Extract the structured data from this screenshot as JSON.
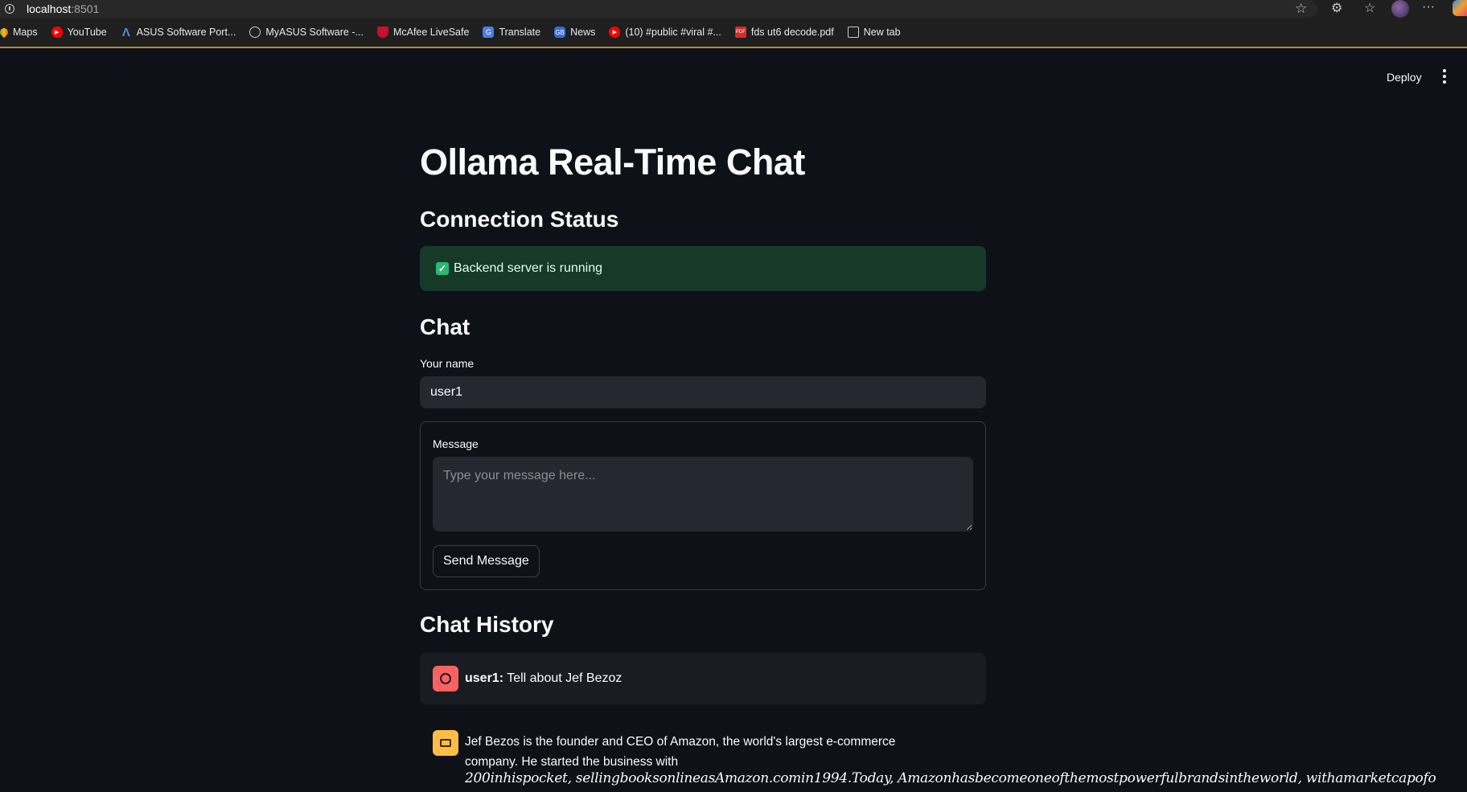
{
  "browser": {
    "url_host": "localhost",
    "url_port": ":8501",
    "bookmarks": [
      {
        "label": "Maps",
        "icon": "maps-icon"
      },
      {
        "label": "YouTube",
        "icon": "youtube-icon"
      },
      {
        "label": "ASUS Software Port...",
        "icon": "asus-icon"
      },
      {
        "label": "MyASUS Software -...",
        "icon": "globe-icon"
      },
      {
        "label": "McAfee LiveSafe",
        "icon": "mcafee-icon"
      },
      {
        "label": "Translate",
        "icon": "translate-icon"
      },
      {
        "label": "News",
        "icon": "news-icon"
      },
      {
        "label": "(10) #public #viral #...",
        "icon": "youtube-icon"
      },
      {
        "label": "fds ut6 decode.pdf",
        "icon": "pdf-icon"
      },
      {
        "label": "New tab",
        "icon": "newtab-icon"
      }
    ]
  },
  "header": {
    "deploy_label": "Deploy"
  },
  "page": {
    "title": "Ollama Real-Time Chat",
    "connection_heading": "Connection Status",
    "status_message": "Backend server is running",
    "chat_heading": "Chat",
    "name_label": "Your name",
    "name_value": "user1",
    "message_label": "Message",
    "message_placeholder": "Type your message here...",
    "send_label": "Send Message",
    "history_heading": "Chat History"
  },
  "chat_history": {
    "user_message": {
      "author": "user1:",
      "text": " Tell about Jef Bezoz"
    },
    "bot_message": {
      "text": "Jef Bezos is the founder and CEO of Amazon, the world's largest e-commerce company. He started the business with",
      "math_overflow": "200inhispocket, sellingbooksonlineasAmazon.comin1994.Today, Amazonhasbecomeoneofthemostpowerfulbrandsintheworld, withamarketcapofo"
    }
  },
  "colors": {
    "background": "#0e1117",
    "success_bg": "#173928",
    "user_avatar": "#ff6161",
    "bot_avatar": "#ffbd45"
  }
}
